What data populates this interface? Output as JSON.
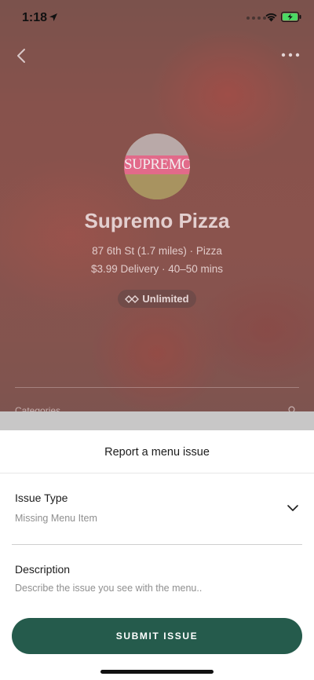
{
  "status_bar": {
    "time": "1:18",
    "icons": [
      "location-arrow-icon",
      "signal-dots-icon",
      "wifi-icon",
      "battery-charging-icon"
    ]
  },
  "nav": {
    "back_icon": "chevron-left-icon",
    "more_icon": "ellipsis-icon"
  },
  "restaurant": {
    "logo_text": "SUPREMO",
    "name": "Supremo Pizza",
    "address_line": "87 6th St (1.7 miles) · Pizza",
    "delivery_line": "$3.99 Delivery · 40–50 mins",
    "badge_label": "Unlimited",
    "categories_label": "Categories"
  },
  "sheet": {
    "title": "Report a menu issue",
    "issue_type_label": "Issue Type",
    "issue_type_value": "Missing Menu Item",
    "description_label": "Description",
    "description_placeholder": "Describe the issue you see with the menu..",
    "submit_label": "SUBMIT ISSUE"
  },
  "colors": {
    "primary_button": "#255b4c",
    "battery_fill": "#4cd964"
  }
}
